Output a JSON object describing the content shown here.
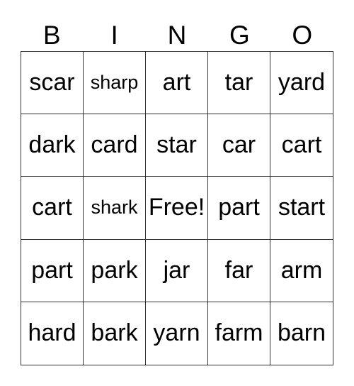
{
  "header": [
    "B",
    "I",
    "N",
    "G",
    "O"
  ],
  "cells": [
    [
      "scar",
      "sharp",
      "art",
      "tar",
      "yard"
    ],
    [
      "dark",
      "card",
      "star",
      "car",
      "cart"
    ],
    [
      "cart",
      "shark",
      "Free!",
      "part",
      "start"
    ],
    [
      "part",
      "park",
      "jar",
      "far",
      "arm"
    ],
    [
      "hard",
      "bark",
      "yarn",
      "farm",
      "barn"
    ]
  ]
}
